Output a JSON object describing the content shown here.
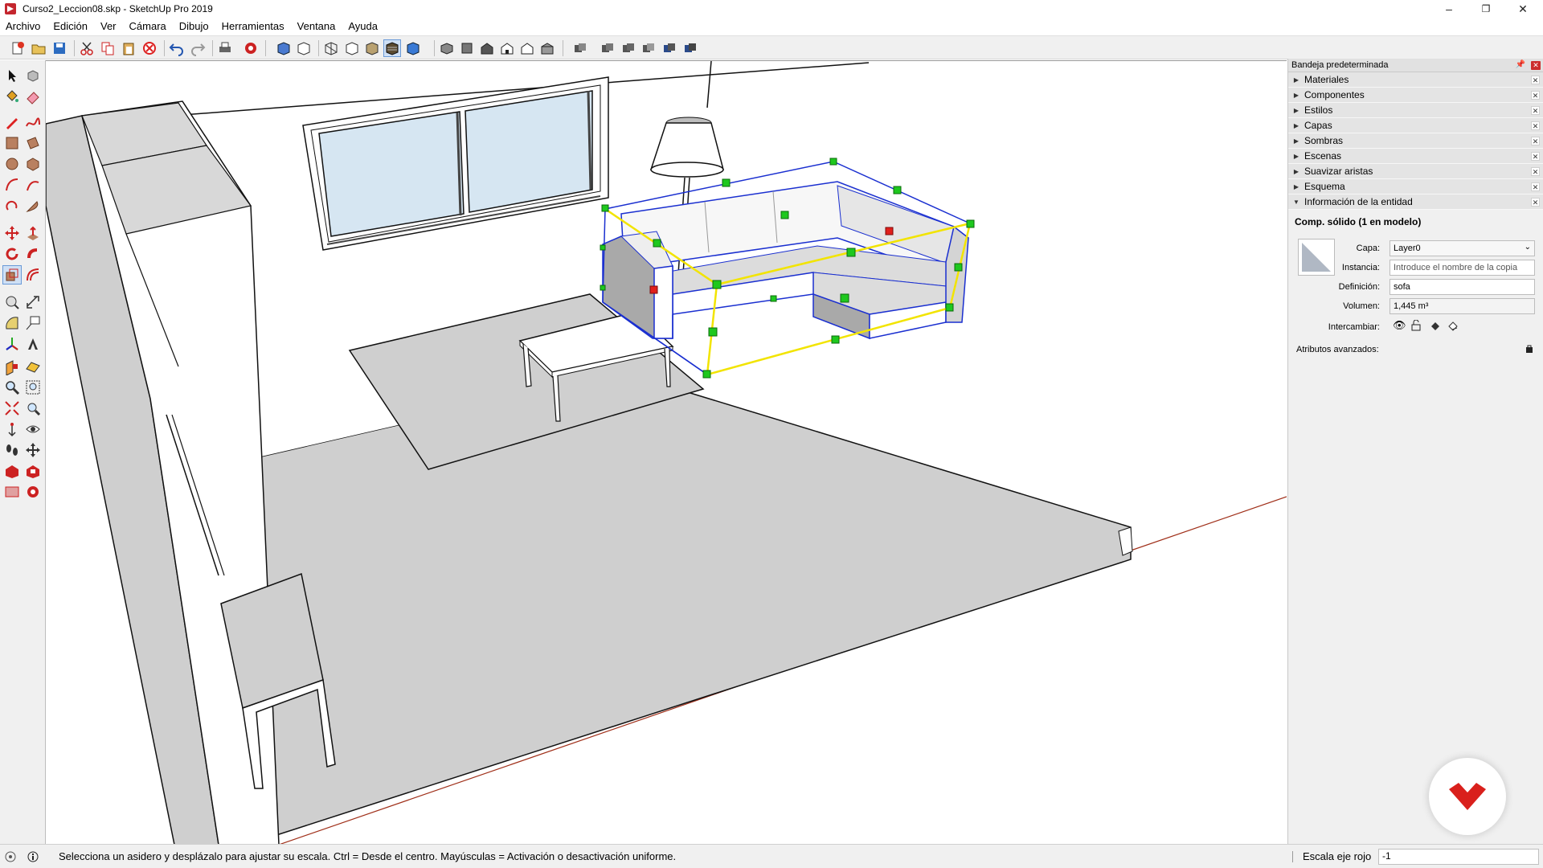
{
  "window": {
    "title": "Curso2_Leccion08.skp - SketchUp Pro 2019",
    "minimize": "–",
    "maximize": "❐",
    "close": "✕"
  },
  "menu": [
    "Archivo",
    "Edición",
    "Ver",
    "Cámara",
    "Dibujo",
    "Herramientas",
    "Ventana",
    "Ayuda"
  ],
  "tray": {
    "title": "Bandeja predeterminada",
    "panels": [
      "Materiales",
      "Componentes",
      "Estilos",
      "Capas",
      "Sombras",
      "Escenas",
      "Suavizar aristas",
      "Esquema",
      "Información de la entidad"
    ],
    "entity_info": {
      "type": "Comp. sólido (1 en modelo)",
      "layer_label": "Capa:",
      "layer_value": "Layer0",
      "instance_label": "Instancia:",
      "instance_placeholder": "Introduce el nombre de la copia",
      "definition_label": "Definición:",
      "definition_value": "sofa",
      "volume_label": "Volumen:",
      "volume_value": "1,445 m³",
      "toggles_label": "Intercambiar:",
      "advanced_label": "Atributos avanzados:"
    }
  },
  "status": {
    "message": "Selecciona un asidero y desplázalo para ajustar su escala. Ctrl = Desde el centro. Mayúsculas = Activación o desactivación uniforme.",
    "measure_label": "Escala eje rojo",
    "measure_value": "-1"
  },
  "colors": {
    "selection_blue": "#1a2fd0",
    "scale_box_yellow": "#f2e400",
    "grip_green": "#1ec81e",
    "grip_red": "#e0201c",
    "brand_red": "#d9201c"
  }
}
